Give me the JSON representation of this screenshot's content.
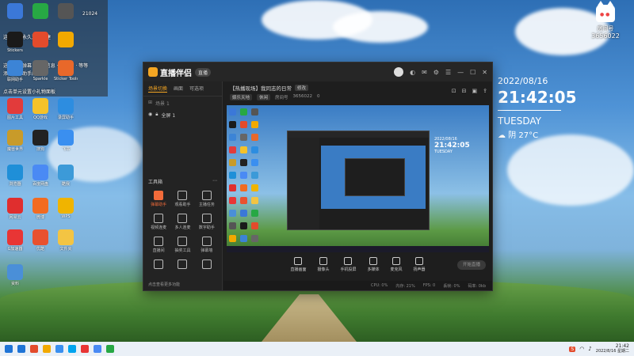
{
  "desktop": {
    "icons": [
      {
        "label": "",
        "color": "#3b78d8"
      },
      {
        "label": "",
        "color": "#27a844"
      },
      {
        "label": "",
        "color": "#555"
      },
      {
        "label": "Stickers",
        "color": "#1a1a1a"
      },
      {
        "label": "",
        "color": "#e34b2c"
      },
      {
        "label": "",
        "color": "#f2a900"
      },
      {
        "label": "联网助手",
        "color": "#3c84d6"
      },
      {
        "label": "Sparkle",
        "color": "#666"
      },
      {
        "label": "Sticker Tools",
        "color": "#e8682a"
      },
      {
        "label": "图片工具",
        "color": "#e23b3b"
      },
      {
        "label": "QQ游戏",
        "color": "#f5c22a"
      },
      {
        "label": "录屏助手",
        "color": "#2d8de0"
      },
      {
        "label": "魔兽世界",
        "color": "#c89b2a"
      },
      {
        "label": "搜狗",
        "color": "#222"
      },
      {
        "label": "飞书",
        "color": "#3a8ff0"
      },
      {
        "label": "浏览器",
        "color": "#1f8fd8"
      },
      {
        "label": "百度网盘",
        "color": "#4a8af4"
      },
      {
        "label": "酷我",
        "color": "#3c9ad8"
      },
      {
        "label": "网易云",
        "color": "#e02e2e"
      },
      {
        "label": "微博",
        "color": "#f26b21"
      },
      {
        "label": "WPS",
        "color": "#f0b400"
      },
      {
        "label": "G加速器",
        "color": "#e83535"
      },
      {
        "label": "优酷",
        "color": "#e9512f"
      },
      {
        "label": "文件夹",
        "color": "#f3c443"
      },
      {
        "label": "资料",
        "color": "#4a8fd8"
      }
    ],
    "log_lines": [
      "这里展示永久选项创建",
      "这里展示弹幕 · 直播信息 · 粉丝牌 · 等等",
      "添加弹幕助手成功",
      "点击单元设置小礼物面板"
    ],
    "top_counter": "21024"
  },
  "widget": {
    "date": "2022/08/16",
    "time": "21:42:05",
    "day": "TUESDAY",
    "weather": "☁ 阴 27°C"
  },
  "corner_badge": {
    "room_label": "房间号",
    "room_id": "3656022"
  },
  "app": {
    "name": "直播伴侣",
    "version_badge": "直播",
    "left_tabs": [
      {
        "label": "场景切换",
        "active": true
      },
      {
        "label": "画面",
        "active": false
      },
      {
        "label": "可选项",
        "active": false
      }
    ],
    "scene_label": "场景 1",
    "source_label": "全屏 1",
    "toolbox_title": "工具箱",
    "tools": [
      {
        "label": "弹幕助手",
        "hot": true
      },
      {
        "label": "观看助手",
        "hot": false
      },
      {
        "label": "主播任务",
        "hot": false
      },
      {
        "label": "视频连麦",
        "hot": false
      },
      {
        "label": "多人连麦",
        "hot": false
      },
      {
        "label": "数字助手",
        "hot": false
      },
      {
        "label": "直播间",
        "hot": false
      },
      {
        "label": "抽奖工具",
        "hot": false
      },
      {
        "label": "弹幕墙",
        "hot": false
      },
      {
        "label": "",
        "hot": false
      },
      {
        "label": "",
        "hot": false
      },
      {
        "label": "",
        "hot": false
      }
    ],
    "left_footer": "点击查看更多功能",
    "room": {
      "title": "【热播现场】我同志的日常",
      "title_tag": "修改",
      "category": "娱乐天地",
      "subcategory": "休闲",
      "room_no_label": "房间号",
      "room_no": "3656022",
      "viewers": "0"
    },
    "mini_widget": {
      "date": "2022/08/16",
      "time": "21:42:05",
      "day": "TUESDAY"
    },
    "controls": [
      "直播画面",
      "摄像头",
      "手机投屏",
      "多媒体",
      "麦克风",
      "扬声器"
    ],
    "go_live_label": "开始直播",
    "status_items": [
      "CPU: 0%",
      "内存: 21%",
      "FPS: 0",
      "丢帧: 0%",
      "码率: 0kb"
    ]
  },
  "taskbar": {
    "time": "21:42",
    "date": "2022/8/16 星期二",
    "apps": [
      "#1f74d6",
      "#e34b2c",
      "#f2a900",
      "#3a8ff0",
      "#00a4ef",
      "#e83535",
      "#4a8af4",
      "#27a844"
    ]
  },
  "colors": {
    "accent": "#f5a623",
    "hot_tool": "#f26b3a"
  }
}
